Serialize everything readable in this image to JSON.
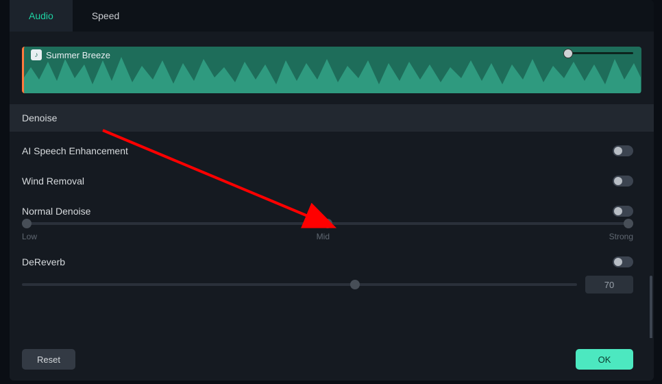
{
  "tabs": {
    "audio": "Audio",
    "speed": "Speed",
    "active": "audio"
  },
  "clip": {
    "title": "Summer Breeze",
    "icon": "music-note"
  },
  "section": {
    "denoise": "Denoise"
  },
  "settings": {
    "ai_speech": {
      "label": "AI Speech Enhancement",
      "enabled": false
    },
    "wind_removal": {
      "label": "Wind Removal",
      "enabled": false
    },
    "normal_denoise": {
      "label": "Normal Denoise",
      "enabled": false,
      "slider": {
        "low": "Low",
        "mid": "Mid",
        "strong": "Strong",
        "value": 50
      }
    },
    "dereverb": {
      "label": "DeReverb",
      "enabled": false,
      "value": "70"
    }
  },
  "footer": {
    "reset": "Reset",
    "ok": "OK"
  },
  "colors": {
    "accent": "#1ed3a4",
    "clip_bg": "#1e6d5a",
    "clip_edge": "#ff7a3d",
    "ok_btn": "#4ce8c0",
    "arrow": "#ff0000"
  }
}
